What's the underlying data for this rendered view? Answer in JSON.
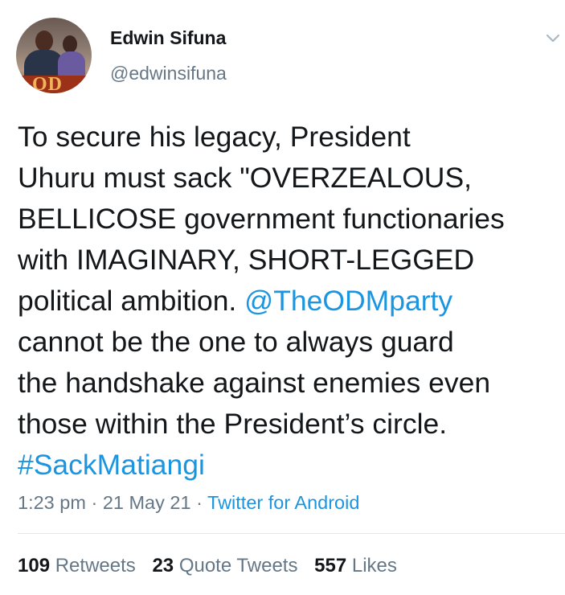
{
  "author": {
    "name": "Edwin Sifuna",
    "handle": "@edwinsifuna",
    "avatar_logo_text": "OD"
  },
  "tweet": {
    "text_line_1": "To secure his legacy, President",
    "text_line_2": "Uhuru must sack \"OVERZEALOUS,",
    "text_line_3": "BELLICOSE government functionaries",
    "text_line_4": "with IMAGINARY, SHORT-LEGGED",
    "text_line_5_prefix": "political ambition. ",
    "mention": "@TheODMparty",
    "text_line_6": "cannot be the one to always guard",
    "text_line_7": "the handshake against enemies even",
    "text_line_8": "those within the President’s circle.",
    "hashtag": "#SackMatiangi"
  },
  "meta": {
    "time": "1:23 pm",
    "separator": " · ",
    "date": "21 May 21",
    "source": "Twitter for Android"
  },
  "stats": {
    "retweets_count": "109",
    "retweets_label": "Retweets",
    "quotes_count": "23",
    "quotes_label": "Quote Tweets",
    "likes_count": "557",
    "likes_label": "Likes"
  },
  "colors": {
    "link": "#1b95e0",
    "secondary_text": "#657786",
    "primary_text": "#14171a"
  },
  "icons": {
    "menu": "chevron-down-icon"
  }
}
